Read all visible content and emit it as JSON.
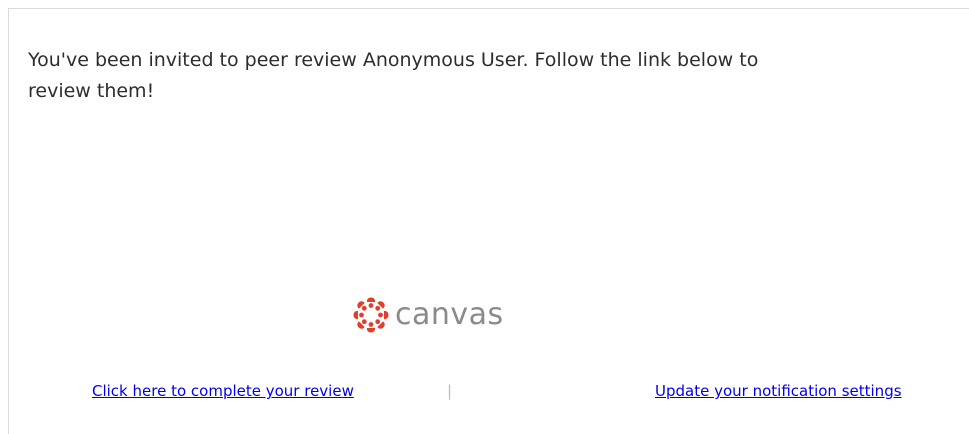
{
  "message": {
    "text": "You've been invited to peer review Anonymous User. Follow the link below to review them!"
  },
  "brand": {
    "name": "canvas",
    "accent_color": "#e13f2b",
    "text_color": "#8a8a8a",
    "icon": "canvas-logo-icon"
  },
  "footer": {
    "review_link_label": "Click here to complete your review",
    "separator": "|",
    "settings_link_label": "Update your notification settings",
    "link_color": "#0000ee"
  }
}
